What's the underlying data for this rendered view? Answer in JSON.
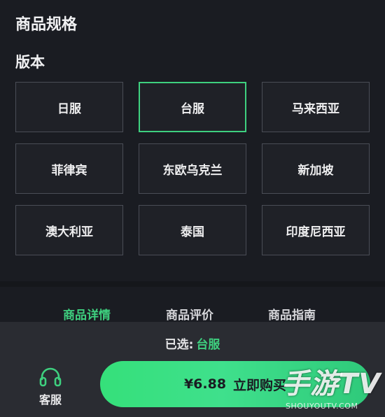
{
  "section_title": "商品规格",
  "group_title": "版本",
  "options": [
    {
      "label": "日服",
      "selected": false
    },
    {
      "label": "台服",
      "selected": true
    },
    {
      "label": "马来西亚",
      "selected": false
    },
    {
      "label": "菲律宾",
      "selected": false
    },
    {
      "label": "东欧乌克兰",
      "selected": false
    },
    {
      "label": "新加坡",
      "selected": false
    },
    {
      "label": "澳大利亚",
      "selected": false
    },
    {
      "label": "泰国",
      "selected": false
    },
    {
      "label": "印度尼西亚",
      "selected": false
    }
  ],
  "tabs": [
    {
      "label": "商品详情",
      "active": true
    },
    {
      "label": "商品评价",
      "active": false
    },
    {
      "label": "商品指南",
      "active": false
    }
  ],
  "bottom": {
    "selected_prefix": "已选:",
    "selected_value": "台服",
    "service_label": "客服",
    "service_icon": "headset-icon",
    "price": "¥6.88",
    "buy_label": "立即购买"
  },
  "watermark": {
    "main": "手游TV",
    "sub": "SHOUYOUTV.COM"
  },
  "colors": {
    "background": "#1a1c22",
    "accent": "#3ed07f",
    "bottom_bar": "#2a2c32"
  }
}
